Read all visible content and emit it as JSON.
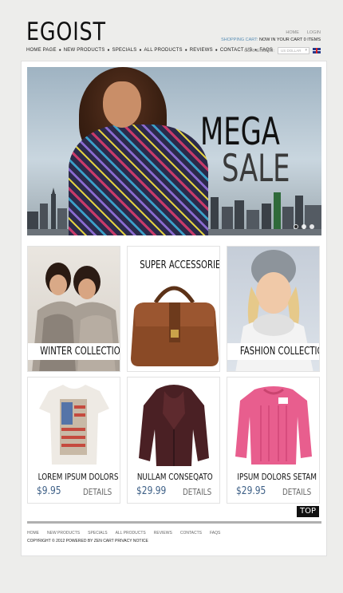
{
  "logo": "EGOIST",
  "nav": [
    "HOME PAGE",
    "NEW PRODUCTS",
    "SPECIALS",
    "ALL PRODUCTS",
    "REVIEWS",
    "CONTACT US",
    "FAQS"
  ],
  "util": {
    "home": "HOME",
    "login": "LOGIN"
  },
  "cart": {
    "label": "SHOPPING CART:",
    "value": "NOW IN YOUR CART 0 ITEMS"
  },
  "currency": {
    "label": "CURRENCIES:",
    "selected": "US DOLLAR"
  },
  "banner": {
    "line1": "MEGA",
    "line2": "SALE",
    "slides": 3,
    "active_slide": 1
  },
  "promos": [
    {
      "caption": "WINTER COLLECTION"
    },
    {
      "caption": "SUPER ACCESSORIES"
    },
    {
      "caption": "FASHION COLLECTION"
    }
  ],
  "products": [
    {
      "name": "LOREM IPSUM DOLORS",
      "price": "$9.95",
      "details": "DETAILS"
    },
    {
      "name": "NULLAM  CONSEQATO",
      "price": "$29.99",
      "details": "DETAILS"
    },
    {
      "name": "IPSUM DOLORS SETAM",
      "price": "$29.95",
      "details": "DETAILS"
    }
  ],
  "top_label": "TOP",
  "footer_nav": [
    "HOME",
    "NEW PRODUCTS",
    "SPECIALS",
    "ALL PRODUCTS",
    "REVIEWS",
    "CONTACTS",
    "FAQS"
  ],
  "copyright": "COPYRIGHT © 2012 POWERED BY ZEN CART PRIVACY NOTICE",
  "colors": {
    "accent_blue": "#5a8fb6",
    "price_blue": "#3d5f86"
  }
}
